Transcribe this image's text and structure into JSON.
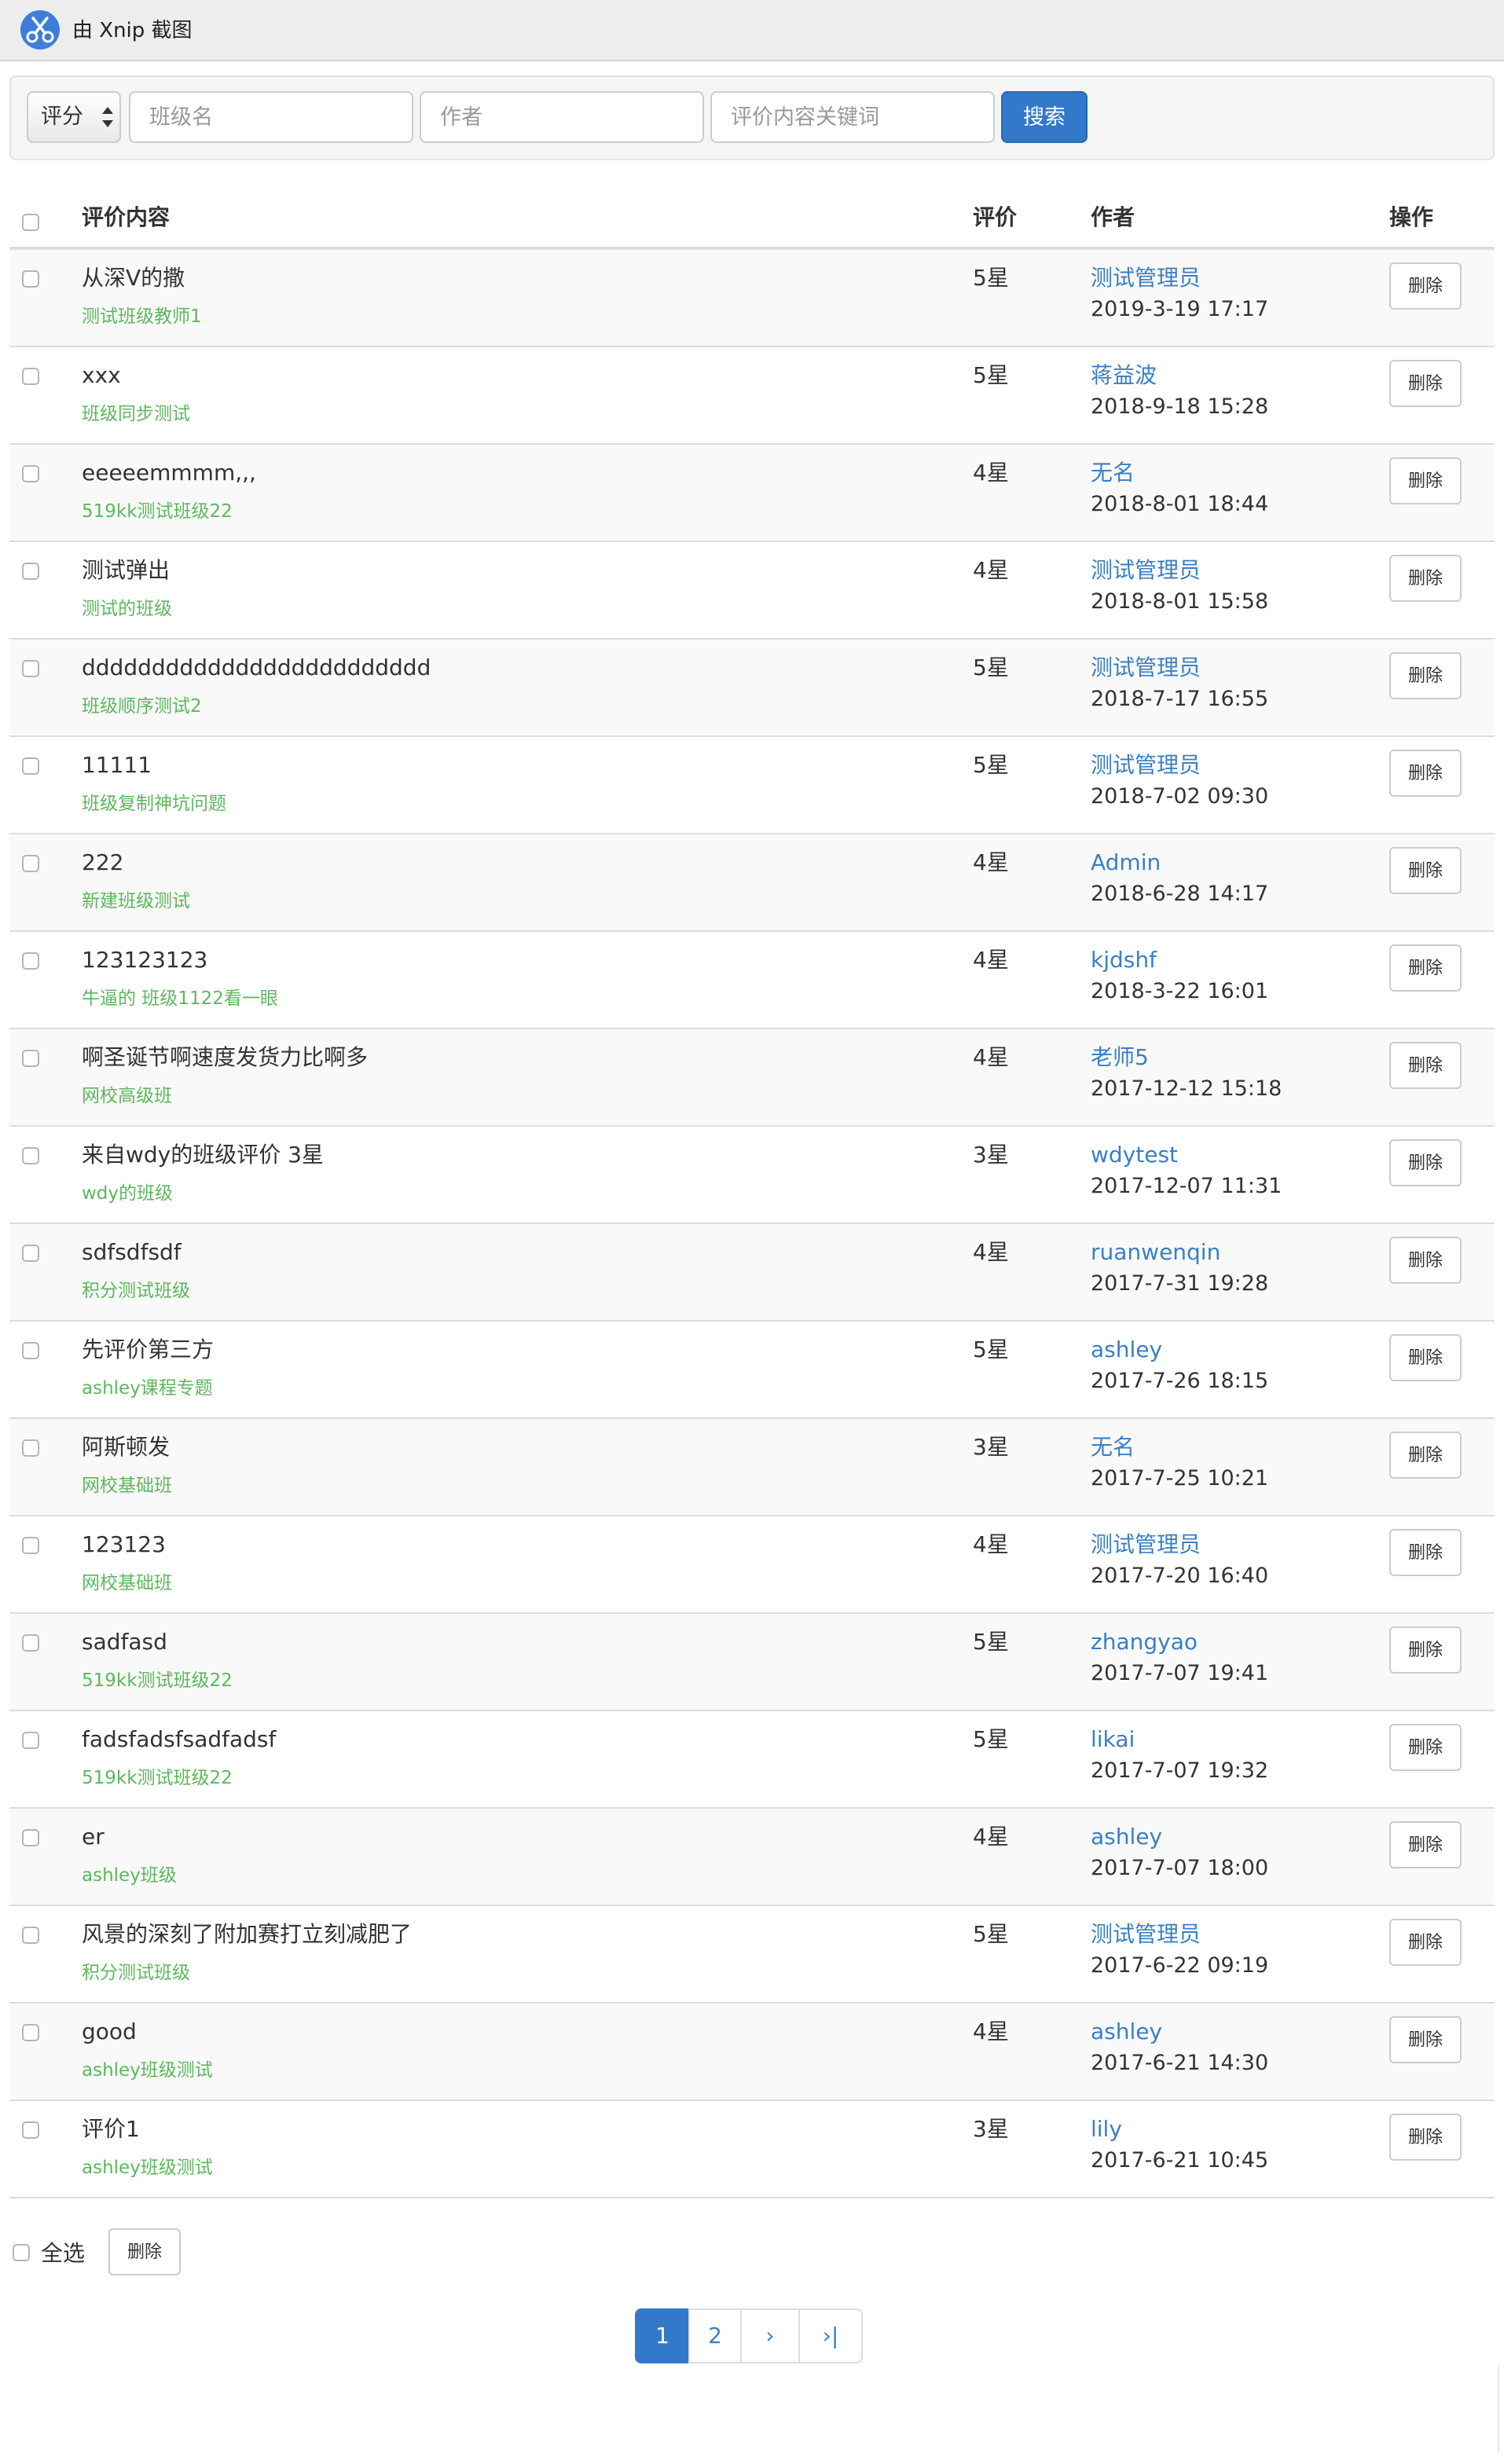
{
  "titlebar": {
    "title": "由 Xnip 截图",
    "logo_icon": "scissors-icon"
  },
  "filter": {
    "rating_select": {
      "selected": "评分"
    },
    "class_name": {
      "value": "",
      "placeholder": "班级名"
    },
    "author": {
      "value": "",
      "placeholder": "作者"
    },
    "keyword": {
      "value": "",
      "placeholder": "评价内容关键词"
    },
    "search_label": "搜索"
  },
  "table": {
    "headers": {
      "content": "评价内容",
      "rating": "评价",
      "author": "作者",
      "action": "操作"
    },
    "rows": [
      {
        "content": "从深V的撒",
        "class_name": "测试班级教师1",
        "rating": "5星",
        "author": "测试管理员",
        "time": "2019-3-19 17:17",
        "delete_label": "删除"
      },
      {
        "content": "xxx",
        "class_name": "班级同步测试",
        "rating": "5星",
        "author": "蒋益波",
        "time": "2018-9-18 15:28",
        "delete_label": "删除"
      },
      {
        "content": "eeeeemmmm,,,",
        "class_name": "519kk测试班级22",
        "rating": "4星",
        "author": "无名",
        "time": "2018-8-01 18:44",
        "delete_label": "删除"
      },
      {
        "content": "测试弹出",
        "class_name": "测试的班级",
        "rating": "4星",
        "author": "测试管理员",
        "time": "2018-8-01 15:58",
        "delete_label": "删除"
      },
      {
        "content": "ddddddddddddddddddddddddd",
        "class_name": "班级顺序测试2",
        "rating": "5星",
        "author": "测试管理员",
        "time": "2018-7-17 16:55",
        "delete_label": "删除"
      },
      {
        "content": "11111",
        "class_name": "班级复制神坑问题",
        "rating": "5星",
        "author": "测试管理员",
        "time": "2018-7-02 09:30",
        "delete_label": "删除"
      },
      {
        "content": "222",
        "class_name": "新建班级测试",
        "rating": "4星",
        "author": "Admin",
        "time": "2018-6-28 14:17",
        "delete_label": "删除"
      },
      {
        "content": "123123123",
        "class_name": "牛逼的 班级1122看一眼",
        "rating": "4星",
        "author": "kjdshf",
        "time": "2018-3-22 16:01",
        "delete_label": "删除"
      },
      {
        "content": "啊圣诞节啊速度发货力比啊多",
        "class_name": "网校高级班",
        "rating": "4星",
        "author": "老师5",
        "time": "2017-12-12 15:18",
        "delete_label": "删除"
      },
      {
        "content": "来自wdy的班级评价 3星",
        "class_name": "wdy的班级",
        "rating": "3星",
        "author": "wdytest",
        "time": "2017-12-07 11:31",
        "delete_label": "删除"
      },
      {
        "content": "sdfsdfsdf",
        "class_name": "积分测试班级",
        "rating": "4星",
        "author": "ruanwenqin",
        "time": "2017-7-31 19:28",
        "delete_label": "删除"
      },
      {
        "content": "先评价第三方",
        "class_name": "ashley课程专题",
        "rating": "5星",
        "author": "ashley",
        "time": "2017-7-26 18:15",
        "delete_label": "删除"
      },
      {
        "content": "阿斯顿发",
        "class_name": "网校基础班",
        "rating": "3星",
        "author": "无名",
        "time": "2017-7-25 10:21",
        "delete_label": "删除"
      },
      {
        "content": "123123",
        "class_name": "网校基础班",
        "rating": "4星",
        "author": "测试管理员",
        "time": "2017-7-20 16:40",
        "delete_label": "删除"
      },
      {
        "content": "sadfasd",
        "class_name": "519kk测试班级22",
        "rating": "5星",
        "author": "zhangyao",
        "time": "2017-7-07 19:41",
        "delete_label": "删除"
      },
      {
        "content": "fadsfadsfsadfadsf",
        "class_name": "519kk测试班级22",
        "rating": "5星",
        "author": "likai",
        "time": "2017-7-07 19:32",
        "delete_label": "删除"
      },
      {
        "content": "er",
        "class_name": "ashley班级",
        "rating": "4星",
        "author": "ashley",
        "time": "2017-7-07 18:00",
        "delete_label": "删除"
      },
      {
        "content": "风景的深刻了附加赛打立刻减肥了",
        "class_name": "积分测试班级",
        "rating": "5星",
        "author": "测试管理员",
        "time": "2017-6-22 09:19",
        "delete_label": "删除"
      },
      {
        "content": "good",
        "class_name": "ashley班级测试",
        "rating": "4星",
        "author": "ashley",
        "time": "2017-6-21 14:30",
        "delete_label": "删除"
      },
      {
        "content": "评价1",
        "class_name": "ashley班级测试",
        "rating": "3星",
        "author": "lily",
        "time": "2017-6-21 10:45",
        "delete_label": "删除"
      }
    ]
  },
  "bulk": {
    "select_all_label": "全选",
    "delete_label": "删除"
  },
  "pagination": {
    "pages": [
      "1",
      "2"
    ],
    "current": "1",
    "next_label": "›",
    "last_label": "›|"
  },
  "colors": {
    "primary": "#3279c9",
    "author_link": "#3a7fc4",
    "class_name": "#5cb85c",
    "stripe": "#f9f9f9"
  }
}
